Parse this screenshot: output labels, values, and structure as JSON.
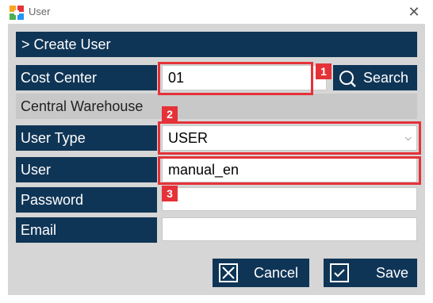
{
  "window": {
    "title": "User"
  },
  "form": {
    "header": "> Create User",
    "cost_center": {
      "label": "Cost Center",
      "value": "01"
    },
    "search_label": "Search",
    "warehouse": "Central Warehouse",
    "user_type": {
      "label": "User Type",
      "value": "USER"
    },
    "user": {
      "label": "User",
      "value": "manual_en"
    },
    "password": {
      "label": "Password",
      "value": ""
    },
    "email": {
      "label": "Email",
      "value": ""
    }
  },
  "buttons": {
    "cancel": "Cancel",
    "save": "Save"
  },
  "annotations": {
    "one": "1",
    "two": "2",
    "three": "3"
  },
  "colors": {
    "panel": "#0f3556",
    "annotation": "#e53238",
    "frame": "#d6d6d6"
  }
}
